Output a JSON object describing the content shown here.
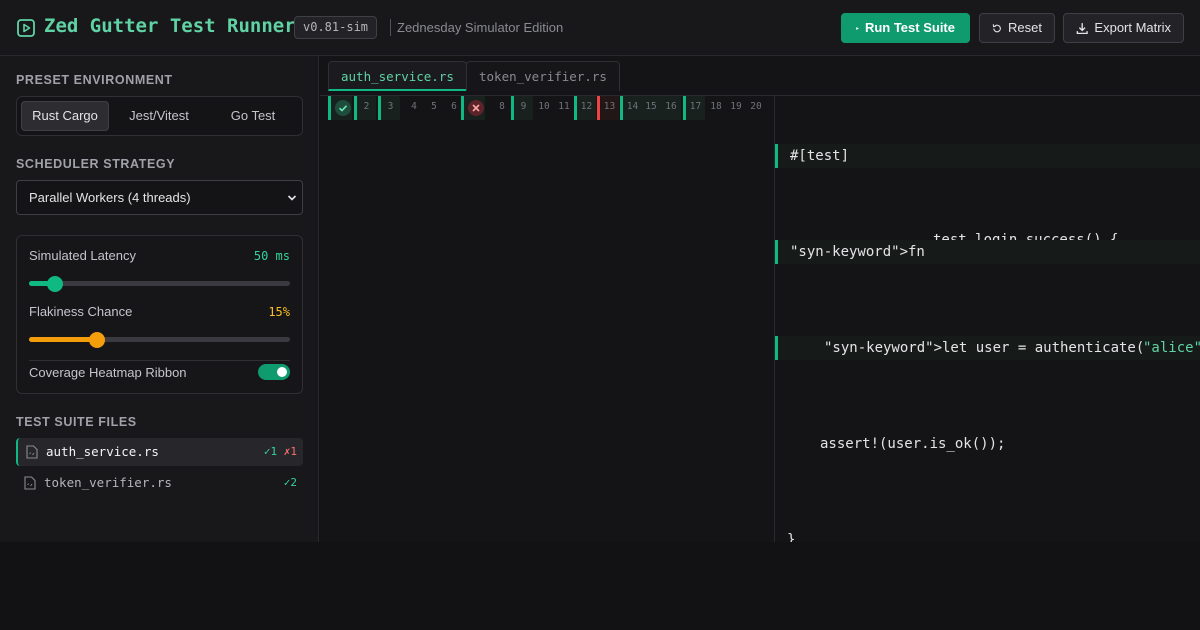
{
  "header": {
    "title": "Zed Gutter Test Runner",
    "version": "v0.81-sim",
    "edition": "Zednesday Simulator Edition",
    "run_label": "Run Test Suite",
    "reset_label": "Reset",
    "export_label": "Export Matrix"
  },
  "sidebar": {
    "preset_heading": "PRESET ENVIRONMENT",
    "presets": [
      {
        "label": "Rust Cargo",
        "active": true
      },
      {
        "label": "Jest/Vitest",
        "active": false
      },
      {
        "label": "Go Test",
        "active": false
      }
    ],
    "strategy_heading": "SCHEDULER STRATEGY",
    "strategy_value": "Parallel Workers (4 threads)",
    "latency_label": "Simulated Latency",
    "latency_value": "50 ms",
    "latency_fraction": 0.1,
    "flakiness_label": "Flakiness Chance",
    "flakiness_value": "15%",
    "flakiness_fraction": 0.26,
    "coverage_label": "Coverage Heatmap Ribbon",
    "coverage_enabled": true,
    "files_heading": "TEST SUITE FILES",
    "files": [
      {
        "name": "auth_service.rs",
        "pass": "✓1",
        "fail": "✗1",
        "active": true
      },
      {
        "name": "token_verifier.rs",
        "pass": "✓2",
        "fail": "",
        "active": false
      }
    ]
  },
  "editor": {
    "tabs": [
      {
        "label": "auth_service.rs",
        "active": true
      },
      {
        "label": "token_verifier.rs",
        "active": false
      }
    ],
    "gutter": [
      "1",
      "2",
      "3",
      "4",
      "5",
      "6",
      "7",
      "8",
      "9",
      "10",
      "11",
      "12",
      "13",
      "14",
      "15",
      "16",
      "17",
      "18",
      "19",
      "20"
    ],
    "code_lines": {
      "l1": "#[test]",
      "l2a": "\"syn-keyword\">fn",
      "l2b": "test_login_success() {",
      "l3a": "\"syn-keyword\">let user = authenticate(",
      "l3b": "\"alice\"",
      "l4": "assert!(user.is_ok());",
      "l5": "}"
    }
  },
  "colors": {
    "accent": "#10b981",
    "title": "#5fd3a3",
    "fail": "#ef4444",
    "warn": "#f59e0b"
  }
}
